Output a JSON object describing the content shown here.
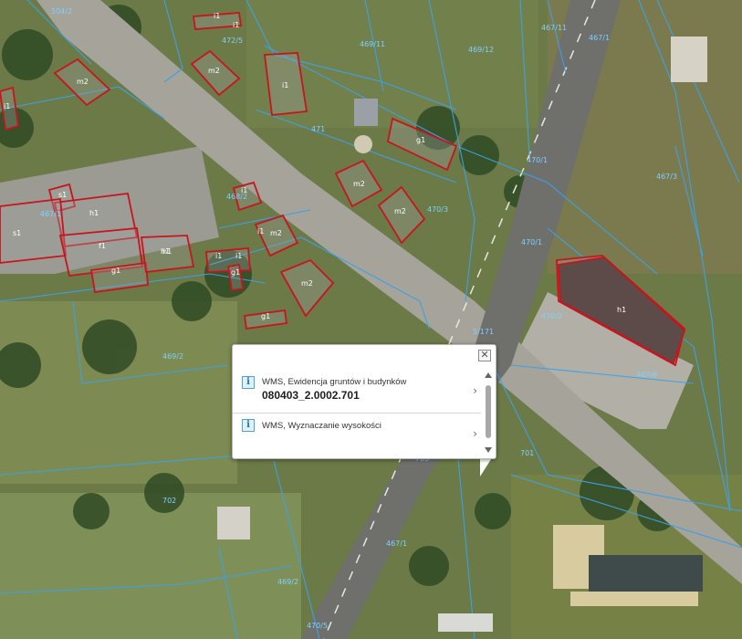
{
  "map": {
    "colors": {
      "parcel_line": "#3da0e8",
      "parcel_label": "#7fd0ff",
      "building_outline": "#c8141c",
      "building_label": "#ffffff",
      "grass": "#6b7a47",
      "road": "#a3a199"
    },
    "parcel_labels": [
      "504/2",
      "472/5",
      "469/11",
      "469/12",
      "467/11",
      "467/1",
      "471",
      "470/1",
      "467/3",
      "470/3",
      "470/1",
      "470/2",
      "467/6",
      "469/2",
      "705",
      "701",
      "702",
      "467/1",
      "469/2",
      "470/5",
      "5/171",
      "467/1",
      "468/2"
    ],
    "building_labels": [
      "i1",
      "i1",
      "m2",
      "m2",
      "i1",
      "i1",
      "g1",
      "s1",
      "h1",
      "h1",
      "s1",
      "f1",
      "h1",
      "i1",
      "m2",
      "m2",
      "g1",
      "m2",
      "i1",
      "i1",
      "i1",
      "g1",
      "h1",
      "m2",
      "g1"
    ]
  },
  "popup": {
    "close_icon": "close-icon",
    "items": [
      {
        "icon": "info-icon",
        "title": "WMS, Ewidencja gruntów i budynków",
        "value": "080403_2.0002.701",
        "chevron": "›"
      },
      {
        "icon": "info-icon",
        "title": "WMS, Wyznaczanie wysokości",
        "value": "",
        "chevron": "›"
      }
    ]
  }
}
